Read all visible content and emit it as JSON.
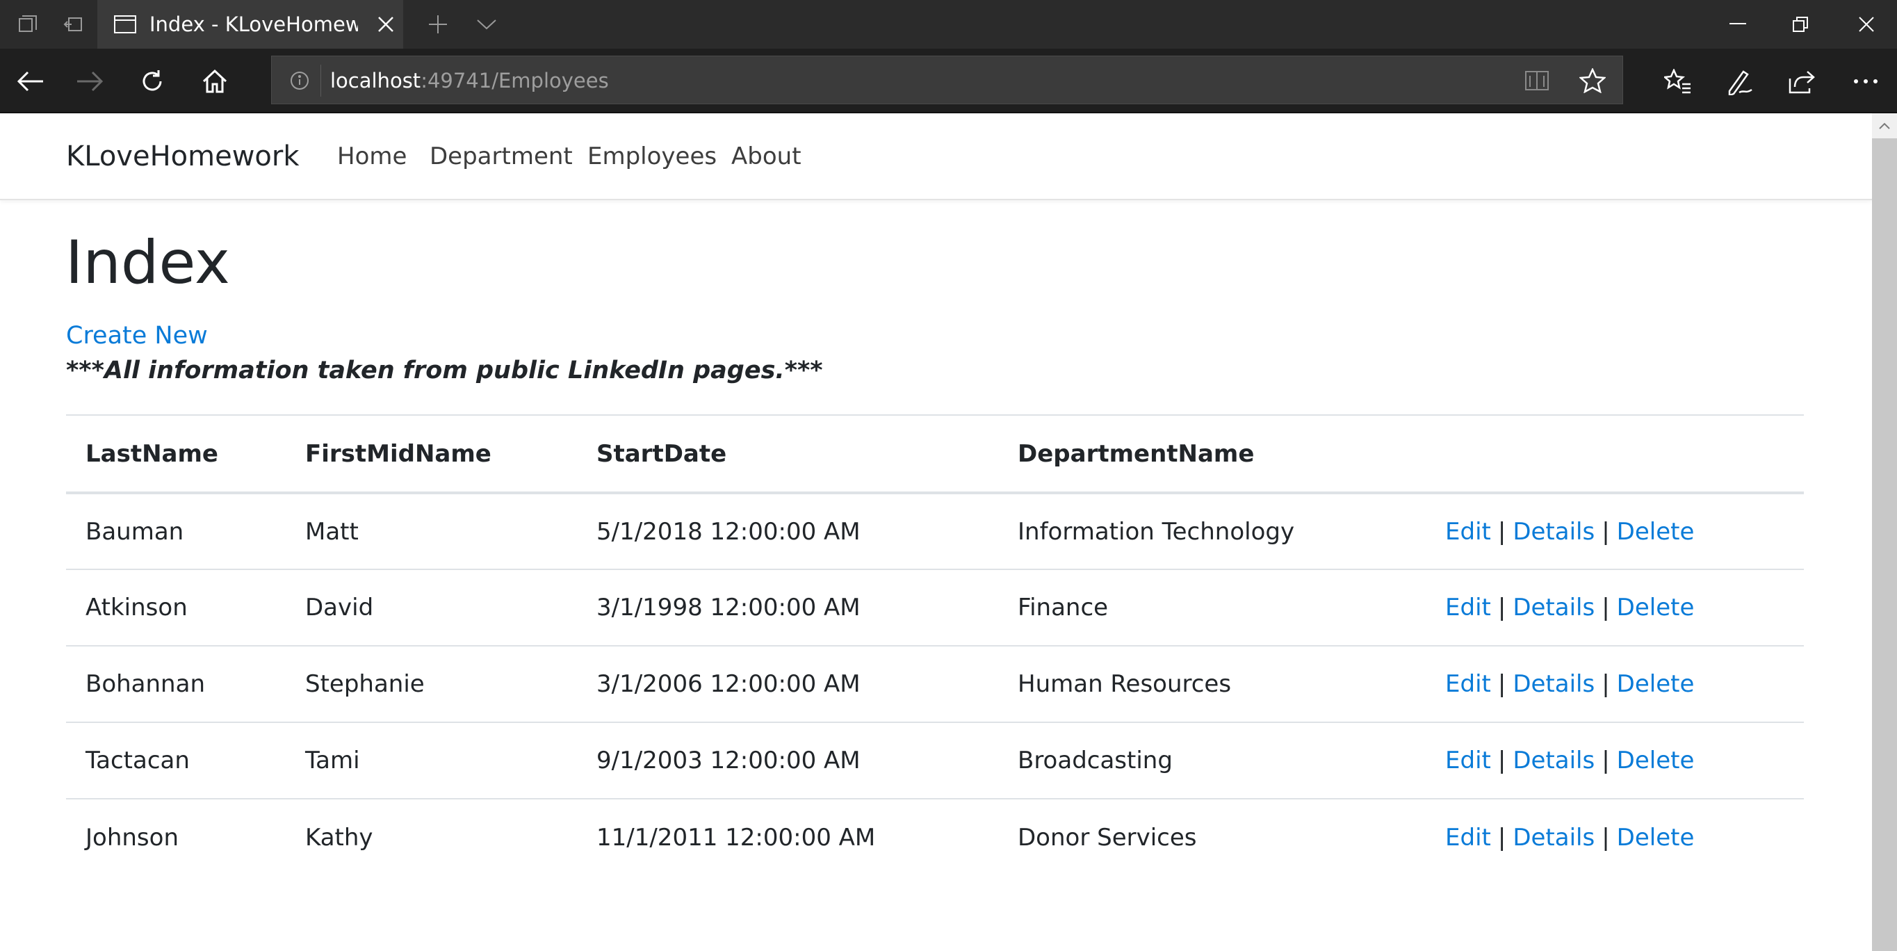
{
  "browser": {
    "tab_title": "Index - KLoveHomewor",
    "url_host": "localhost",
    "url_rest": ":49741/Employees"
  },
  "site": {
    "brand": "KLoveHomework",
    "nav": {
      "home": "Home",
      "department": "Department",
      "employees": "Employees",
      "about": "About"
    }
  },
  "main": {
    "title": "Index",
    "create_new": "Create New",
    "note": "***All information taken from public LinkedIn pages.***"
  },
  "table": {
    "headers": {
      "last_name": "LastName",
      "first_mid_name": "FirstMidName",
      "start_date": "StartDate",
      "department_name": "DepartmentName"
    },
    "rows": [
      {
        "last_name": "Bauman",
        "first_mid_name": "Matt",
        "start_date": "5/1/2018 12:00:00 AM",
        "department_name": "Information Technology"
      },
      {
        "last_name": "Atkinson",
        "first_mid_name": "David",
        "start_date": "3/1/1998 12:00:00 AM",
        "department_name": "Finance"
      },
      {
        "last_name": "Bohannan",
        "first_mid_name": "Stephanie",
        "start_date": "3/1/2006 12:00:00 AM",
        "department_name": "Human Resources"
      },
      {
        "last_name": "Tactacan",
        "first_mid_name": "Tami",
        "start_date": "9/1/2003 12:00:00 AM",
        "department_name": "Broadcasting"
      },
      {
        "last_name": "Johnson",
        "first_mid_name": "Kathy",
        "start_date": "11/1/2011 12:00:00 AM",
        "department_name": "Donor Services"
      }
    ],
    "actions": {
      "edit": "Edit",
      "separator": "|",
      "details": "Details",
      "delete": "Delete"
    }
  },
  "colors": {
    "link": "#0a7bd8",
    "chrome_dark": "#2b2b2b",
    "text": "#212529"
  }
}
